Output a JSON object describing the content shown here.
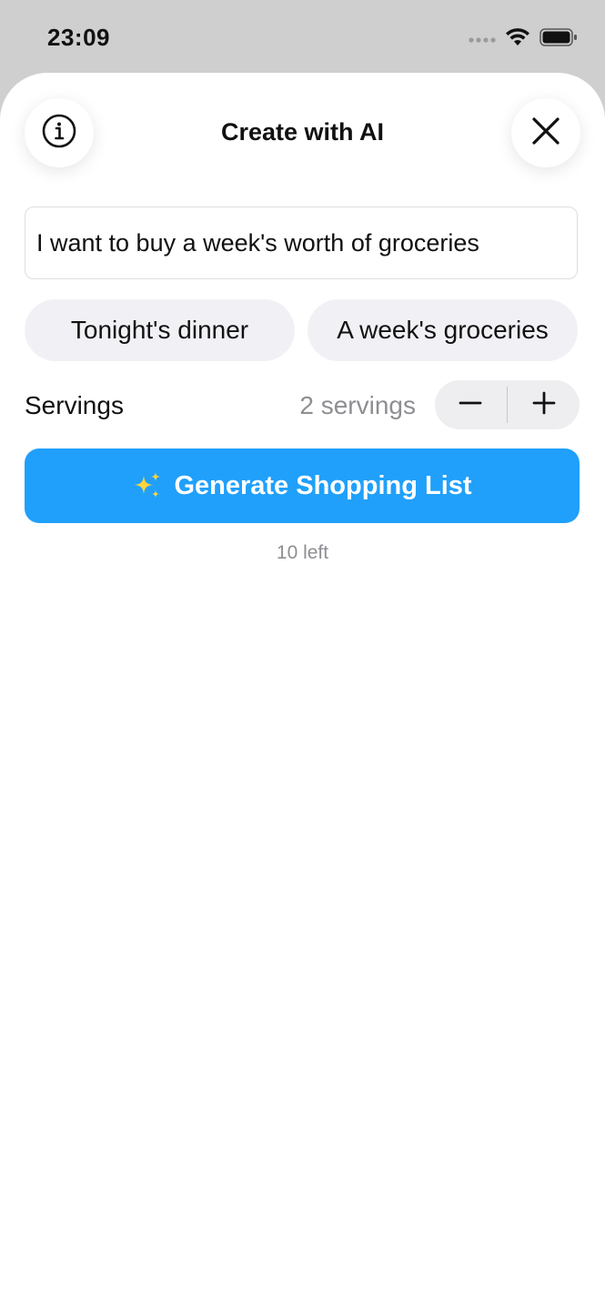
{
  "status_bar": {
    "time": "23:09",
    "icons": [
      "cellular-dots-icon",
      "wifi-icon",
      "battery-icon"
    ]
  },
  "sheet": {
    "title": "Create with AI",
    "info_icon": "info-circle-icon",
    "close_icon": "close-x-icon"
  },
  "prompt": {
    "value": "I want to buy a week's worth of groceries"
  },
  "suggestions": [
    {
      "label": "Tonight's dinner"
    },
    {
      "label": "A week's groceries"
    }
  ],
  "servings": {
    "label": "Servings",
    "value": "2 servings",
    "decrement_icon": "minus-icon",
    "increment_icon": "plus-icon"
  },
  "generate": {
    "icon": "sparkles-icon",
    "label": "Generate Shopping List"
  },
  "remaining": "10 left",
  "colors": {
    "accent": "#20a0fb",
    "chip_bg": "#f1f1f5",
    "secondary_text": "#8e8e93"
  }
}
